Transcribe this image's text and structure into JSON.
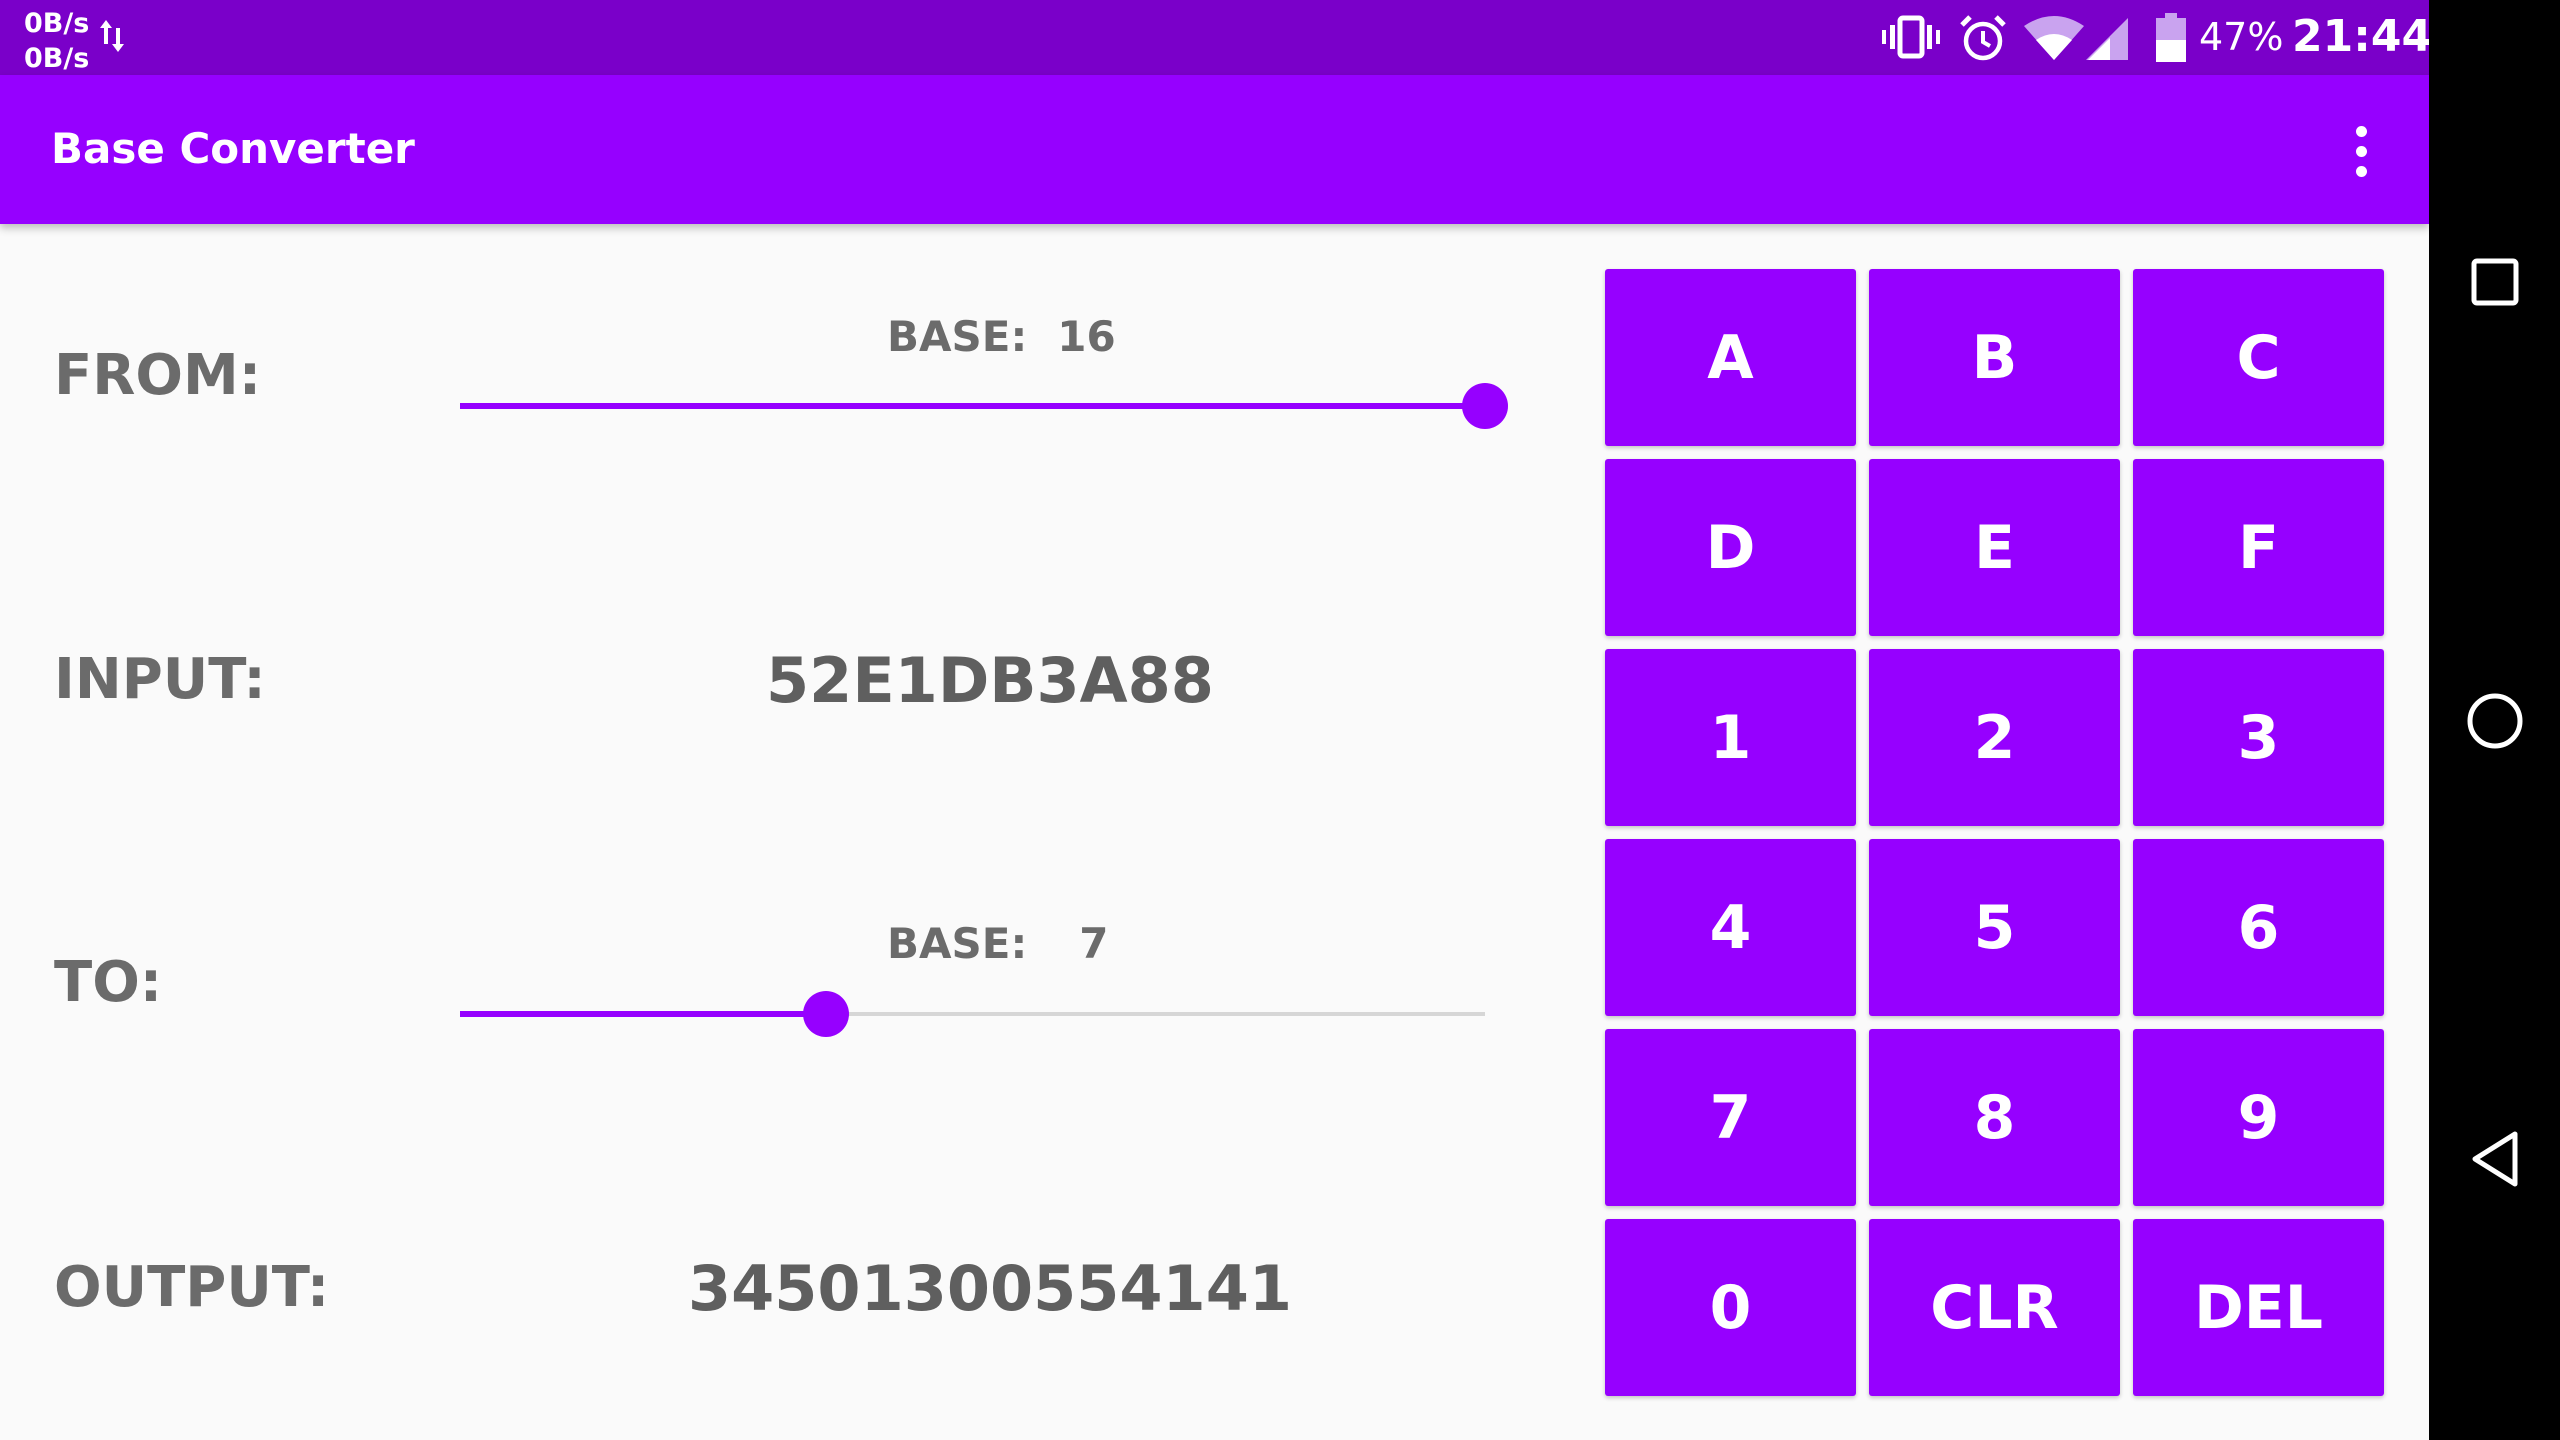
{
  "status_bar": {
    "net_up": "0B/s",
    "net_down": "0B/s",
    "battery_percent": "47%",
    "time": "21:44",
    "icons": [
      "data-transfer-icon",
      "vibrate-icon",
      "alarm-icon",
      "wifi-icon",
      "cell-signal-icon",
      "battery-icon"
    ]
  },
  "app_bar": {
    "title": "Base Converter",
    "menu_icon": "more-vert-icon"
  },
  "converter": {
    "from_label": "FROM:",
    "from_base_caption": "BASE:",
    "from_base_value": "16",
    "from_slider_fraction": 1.0,
    "input_label": "INPUT:",
    "input_value": "52E1DB3A88",
    "to_label": "TO:",
    "to_base_caption": "BASE:",
    "to_base_value": "7",
    "to_slider_fraction": 0.357,
    "output_label": "OUTPUT:",
    "output_value": "34501300554141"
  },
  "keypad": {
    "keys": [
      "A",
      "B",
      "C",
      "D",
      "E",
      "F",
      "1",
      "2",
      "3",
      "4",
      "5",
      "6",
      "7",
      "8",
      "9",
      "0",
      "CLR",
      "DEL"
    ]
  },
  "nav_bar": {
    "buttons": [
      "recents-square-icon",
      "home-circle-icon",
      "back-triangle-icon"
    ]
  },
  "colors": {
    "status_bar": "#7a00c9",
    "accent": "#9600ff",
    "text_secondary": "#6b6b6b",
    "background": "#fafafa"
  }
}
